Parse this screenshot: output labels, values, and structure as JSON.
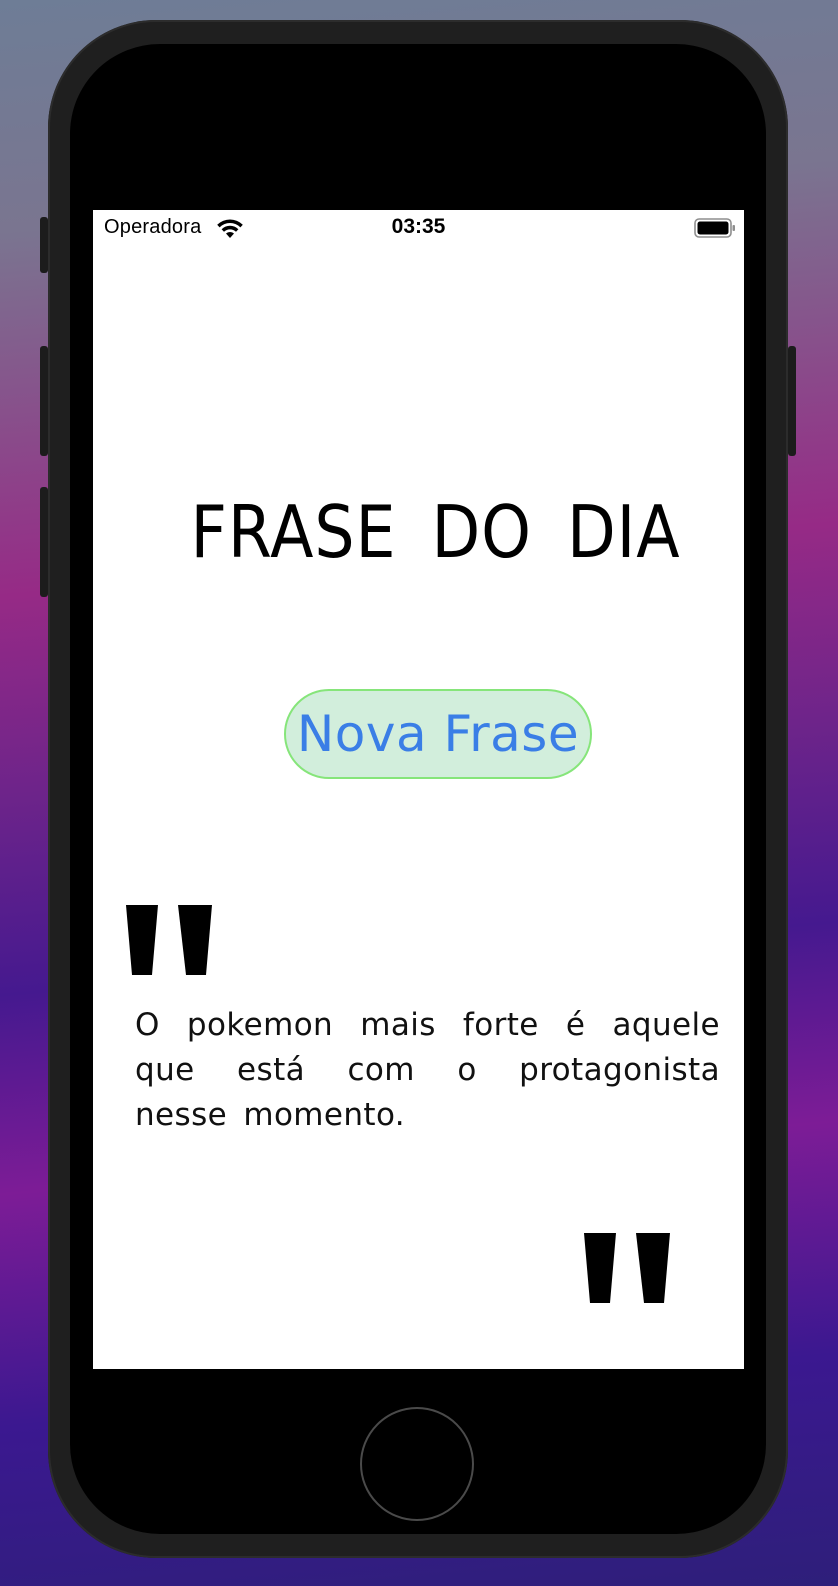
{
  "status_bar": {
    "carrier": "Operadora",
    "time": "03:35",
    "wifi_icon": "wifi-icon",
    "battery_icon": "battery-icon"
  },
  "app": {
    "title": "FRASE DO DIA",
    "new_phrase_button": "Nova Frase",
    "quote": "O pokemon mais forte é aquele que está com o protagonista nesse momento.",
    "quote_open_icon": "quote-mark-icon",
    "quote_close_icon": "quote-mark-icon"
  },
  "colors": {
    "button_background": "#d2eedc",
    "button_border": "#86e57a",
    "button_text": "#3a7ee6"
  }
}
